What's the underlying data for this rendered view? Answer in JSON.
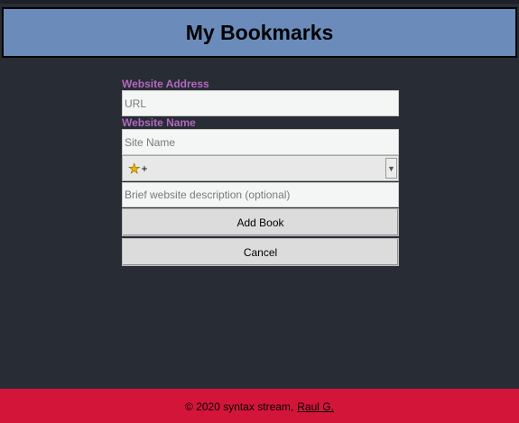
{
  "header": {
    "title": "My Bookmarks"
  },
  "form": {
    "url_label": "Website Address",
    "url_placeholder": "URL",
    "name_label": "Website Name",
    "name_placeholder": "Site Name",
    "rating_select": {
      "selected": "+",
      "icon": "star-icon"
    },
    "description_placeholder": "Brief website description (optional)",
    "add_button_label": "Add Book",
    "cancel_button_label": "Cancel"
  },
  "footer": {
    "text": "© 2020 syntax stream,",
    "author_link": "Raul G."
  },
  "colors": {
    "header_bg": "#6b8cba",
    "page_bg": "#282c34",
    "label": "#b466c2",
    "footer_bg": "#d4153a"
  }
}
